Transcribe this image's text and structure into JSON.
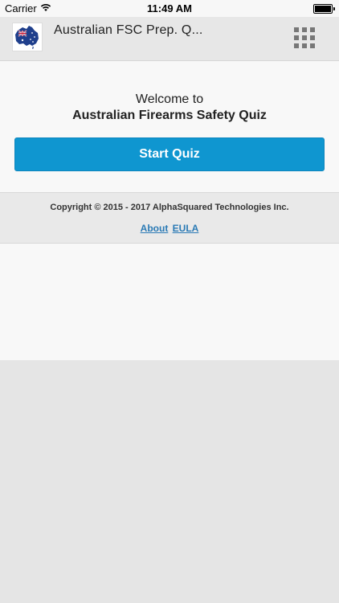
{
  "status_bar": {
    "carrier": "Carrier",
    "time": "11:49 AM",
    "wifi_icon": "wifi-icon",
    "battery_icon": "battery-icon"
  },
  "header": {
    "title": "Australian FSC Prep. Q...",
    "logo": "australia-map-flag-logo",
    "menu_icon": "grid-icon"
  },
  "main": {
    "welcome": "Welcome to",
    "quiz_title": "Australian Firearms Safety Quiz",
    "start_label": "Start Quiz"
  },
  "footer": {
    "copyright": "Copyright © 2015 - 2017 AlphaSquared Technologies Inc.",
    "about_label": "About",
    "eula_label": "EULA"
  },
  "colors": {
    "accent": "#0f96d0",
    "link": "#2a7ab5"
  }
}
